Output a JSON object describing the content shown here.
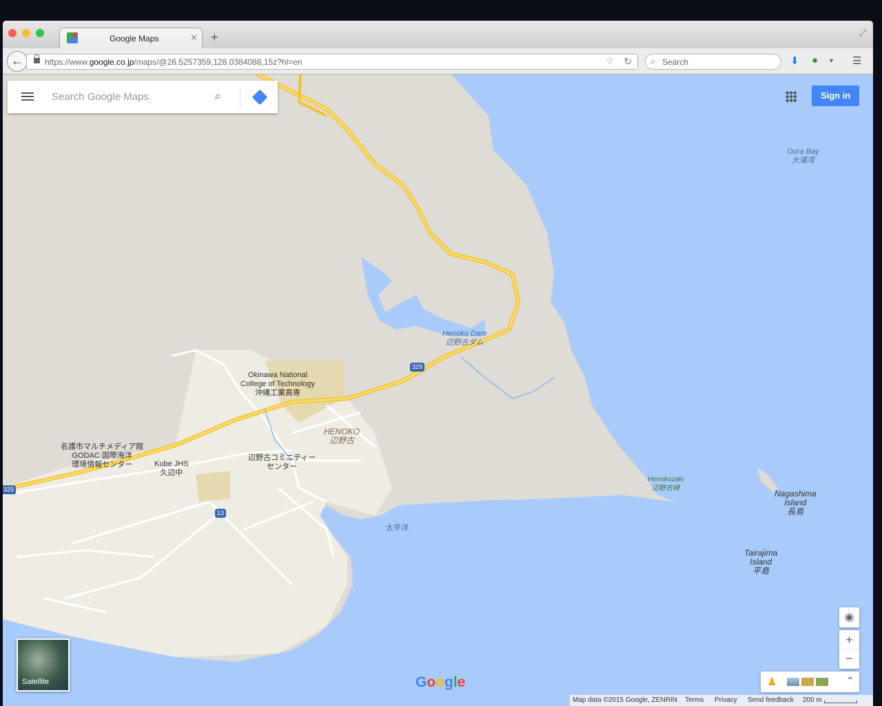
{
  "browser": {
    "tab_title": "Google Maps",
    "url_prefix": "https://www.",
    "url_domain": "google.co.jp",
    "url_path": "/maps/@26.5257359,128.0384088,15z?hl=en",
    "search_placeholder": "Search"
  },
  "maps": {
    "search_placeholder": "Search Google Maps",
    "sign_in": "Sign in",
    "satellite_label": "Satellite",
    "logo": "Google",
    "footer": {
      "map_data": "Map data ©2015 Google, ZENRIN",
      "terms": "Terms",
      "privacy": "Privacy",
      "feedback": "Send feedback",
      "scale": "200 m"
    },
    "labels": {
      "oura_en": "Oura Bay",
      "oura_jp": "大浦湾",
      "dam_en": "Henoko Dam",
      "dam_jp": "辺野古ダム",
      "college1": "Okinawa National",
      "college2": "College of Technology",
      "college_jp": "沖縄工業高専",
      "henoko_en": "HENOKO",
      "henoko_jp": "辺野古",
      "community1": "辺野古コミニティー",
      "community2": "センター",
      "media1": "名護市マルチメディア館",
      "media2": "GODAC 国際海洋",
      "media3": "環境情報センター",
      "kube1": "Kube JHS",
      "kube2": "久辺中",
      "pacific": "太平洋",
      "henokozaki_en": "Henokozaki",
      "henokozaki_jp": "辺野古崎",
      "naga1": "Nagashima",
      "naga2": "Island",
      "naga3": "長島",
      "taira1": "Tairajima",
      "taira2": "Island",
      "taira3": "平島",
      "route329": "329",
      "route13": "13"
    }
  },
  "colors": {
    "water": "#a9cbfb",
    "land": "#dfdbd5",
    "urban": "#efece4",
    "road": "#f9d04a",
    "accent": "#4285f4"
  }
}
